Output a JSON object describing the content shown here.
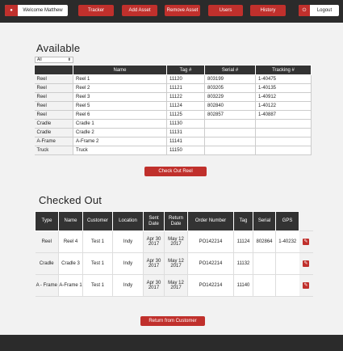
{
  "nav": {
    "welcome": "Welcome Matthew",
    "tracker": "Tracker",
    "add_asset": "Add Asset",
    "remove_asset": "Remove Asset",
    "users": "Users",
    "history": "History",
    "logout": "Logout"
  },
  "available": {
    "title": "Available",
    "filter_value": "All",
    "headers": [
      "",
      "Name",
      "Tag #",
      "Serial #",
      "Tracking #"
    ],
    "rows": [
      [
        "Reel",
        "Reel 1",
        "11120",
        "803199",
        "1-40475"
      ],
      [
        "Reel",
        "Reel 2",
        "11121",
        "803205",
        "1-40135"
      ],
      [
        "Reel",
        "Reel 3",
        "11122",
        "803229",
        "1-40912"
      ],
      [
        "Reel",
        "Reel 5",
        "11124",
        "802840",
        "1-40122"
      ],
      [
        "Reel",
        "Reel 6",
        "11125",
        "802857",
        "1-40887"
      ],
      [
        "Cradle",
        "Cradle 1",
        "11130",
        "",
        ""
      ],
      [
        "Cradle",
        "Cradle 2",
        "11131",
        "",
        ""
      ],
      [
        "A-Frame",
        "A-Frame 2",
        "11141",
        "",
        ""
      ],
      [
        "Truck",
        "Truck",
        "11150",
        "",
        ""
      ]
    ],
    "checkout_button": "Check Out Reel"
  },
  "checked_out": {
    "title": "Checked Out",
    "headers": [
      "Type",
      "Name",
      "Customer",
      "Location",
      "Sent Date",
      "Return Date",
      "Order Number",
      "Tag",
      "Serial",
      "GPS"
    ],
    "rows": [
      [
        "Reel",
        "Reel 4",
        "Test 1",
        "Indy",
        "Apr 30 2017",
        "May 12 2017",
        "PO142214",
        "11124",
        "802864",
        "1-40232"
      ],
      [
        "Cradle",
        "Cradle 3",
        "Test 1",
        "Indy",
        "Apr 30 2017",
        "May 12 2017",
        "PO142214",
        "11132",
        "",
        ""
      ],
      [
        "A - Frame",
        "A-Frame 1",
        "Test 1",
        "Indy",
        "Apr 30 2017",
        "May 12 2017",
        "PO142214",
        "11140",
        "",
        ""
      ]
    ],
    "return_button": "Return from Customer"
  },
  "icons": {
    "edit": "edit-icon",
    "welcome": "user-icon",
    "logout": "power-icon"
  },
  "colors": {
    "accent": "#c0302c",
    "bar": "#2b2b2b",
    "header": "#333333",
    "page": "#f2f2f2"
  }
}
